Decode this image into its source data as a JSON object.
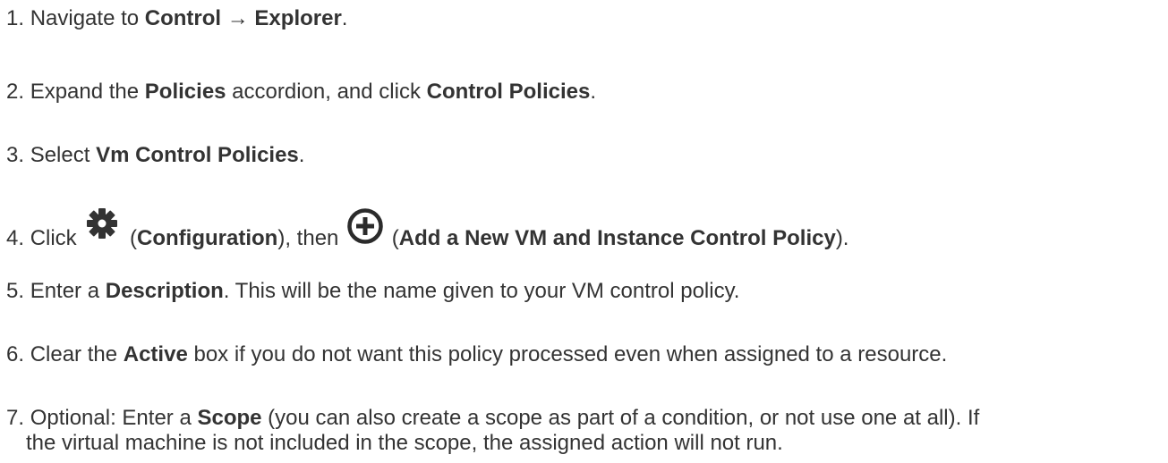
{
  "steps": [
    {
      "num": "1.",
      "t1": "Navigate to ",
      "b1": "Control",
      "t2": " → ",
      "b2": "Explorer",
      "t3": "."
    },
    {
      "num": "2.",
      "t1": "Expand the ",
      "b1": "Policies",
      "t2": " accordion, and click ",
      "b2": "Control Policies",
      "t3": "."
    },
    {
      "num": "3.",
      "t1": "Select ",
      "b1": "Vm Control Policies",
      "t2": "."
    },
    {
      "num": "4.",
      "t1": "Click ",
      "icon1": "gear-icon",
      "t2": " (",
      "b1": "Configuration",
      "t3": "), then ",
      "icon2": "plus-circle-icon",
      "t4": " (",
      "b2": "Add a New VM and Instance Control Policy",
      "t5": ")."
    },
    {
      "num": "5.",
      "t1": "Enter a ",
      "b1": "Description",
      "t2": ". This will be the name given to your VM control policy."
    },
    {
      "num": "6.",
      "t1": "Clear the ",
      "b1": "Active",
      "t2": " box if you do not want this policy processed even when assigned to a resource."
    },
    {
      "num": "7.",
      "t1": "Optional: Enter a ",
      "b1": "Scope",
      "t2": " (you can also create a scope as part of a condition, or not use one at all). If",
      "t3": "the virtual machine is not included in the scope, the assigned action will not run."
    }
  ],
  "colors": {
    "text": "#333333",
    "gear": "#333333",
    "plus_circle": "#2b2b2b"
  }
}
